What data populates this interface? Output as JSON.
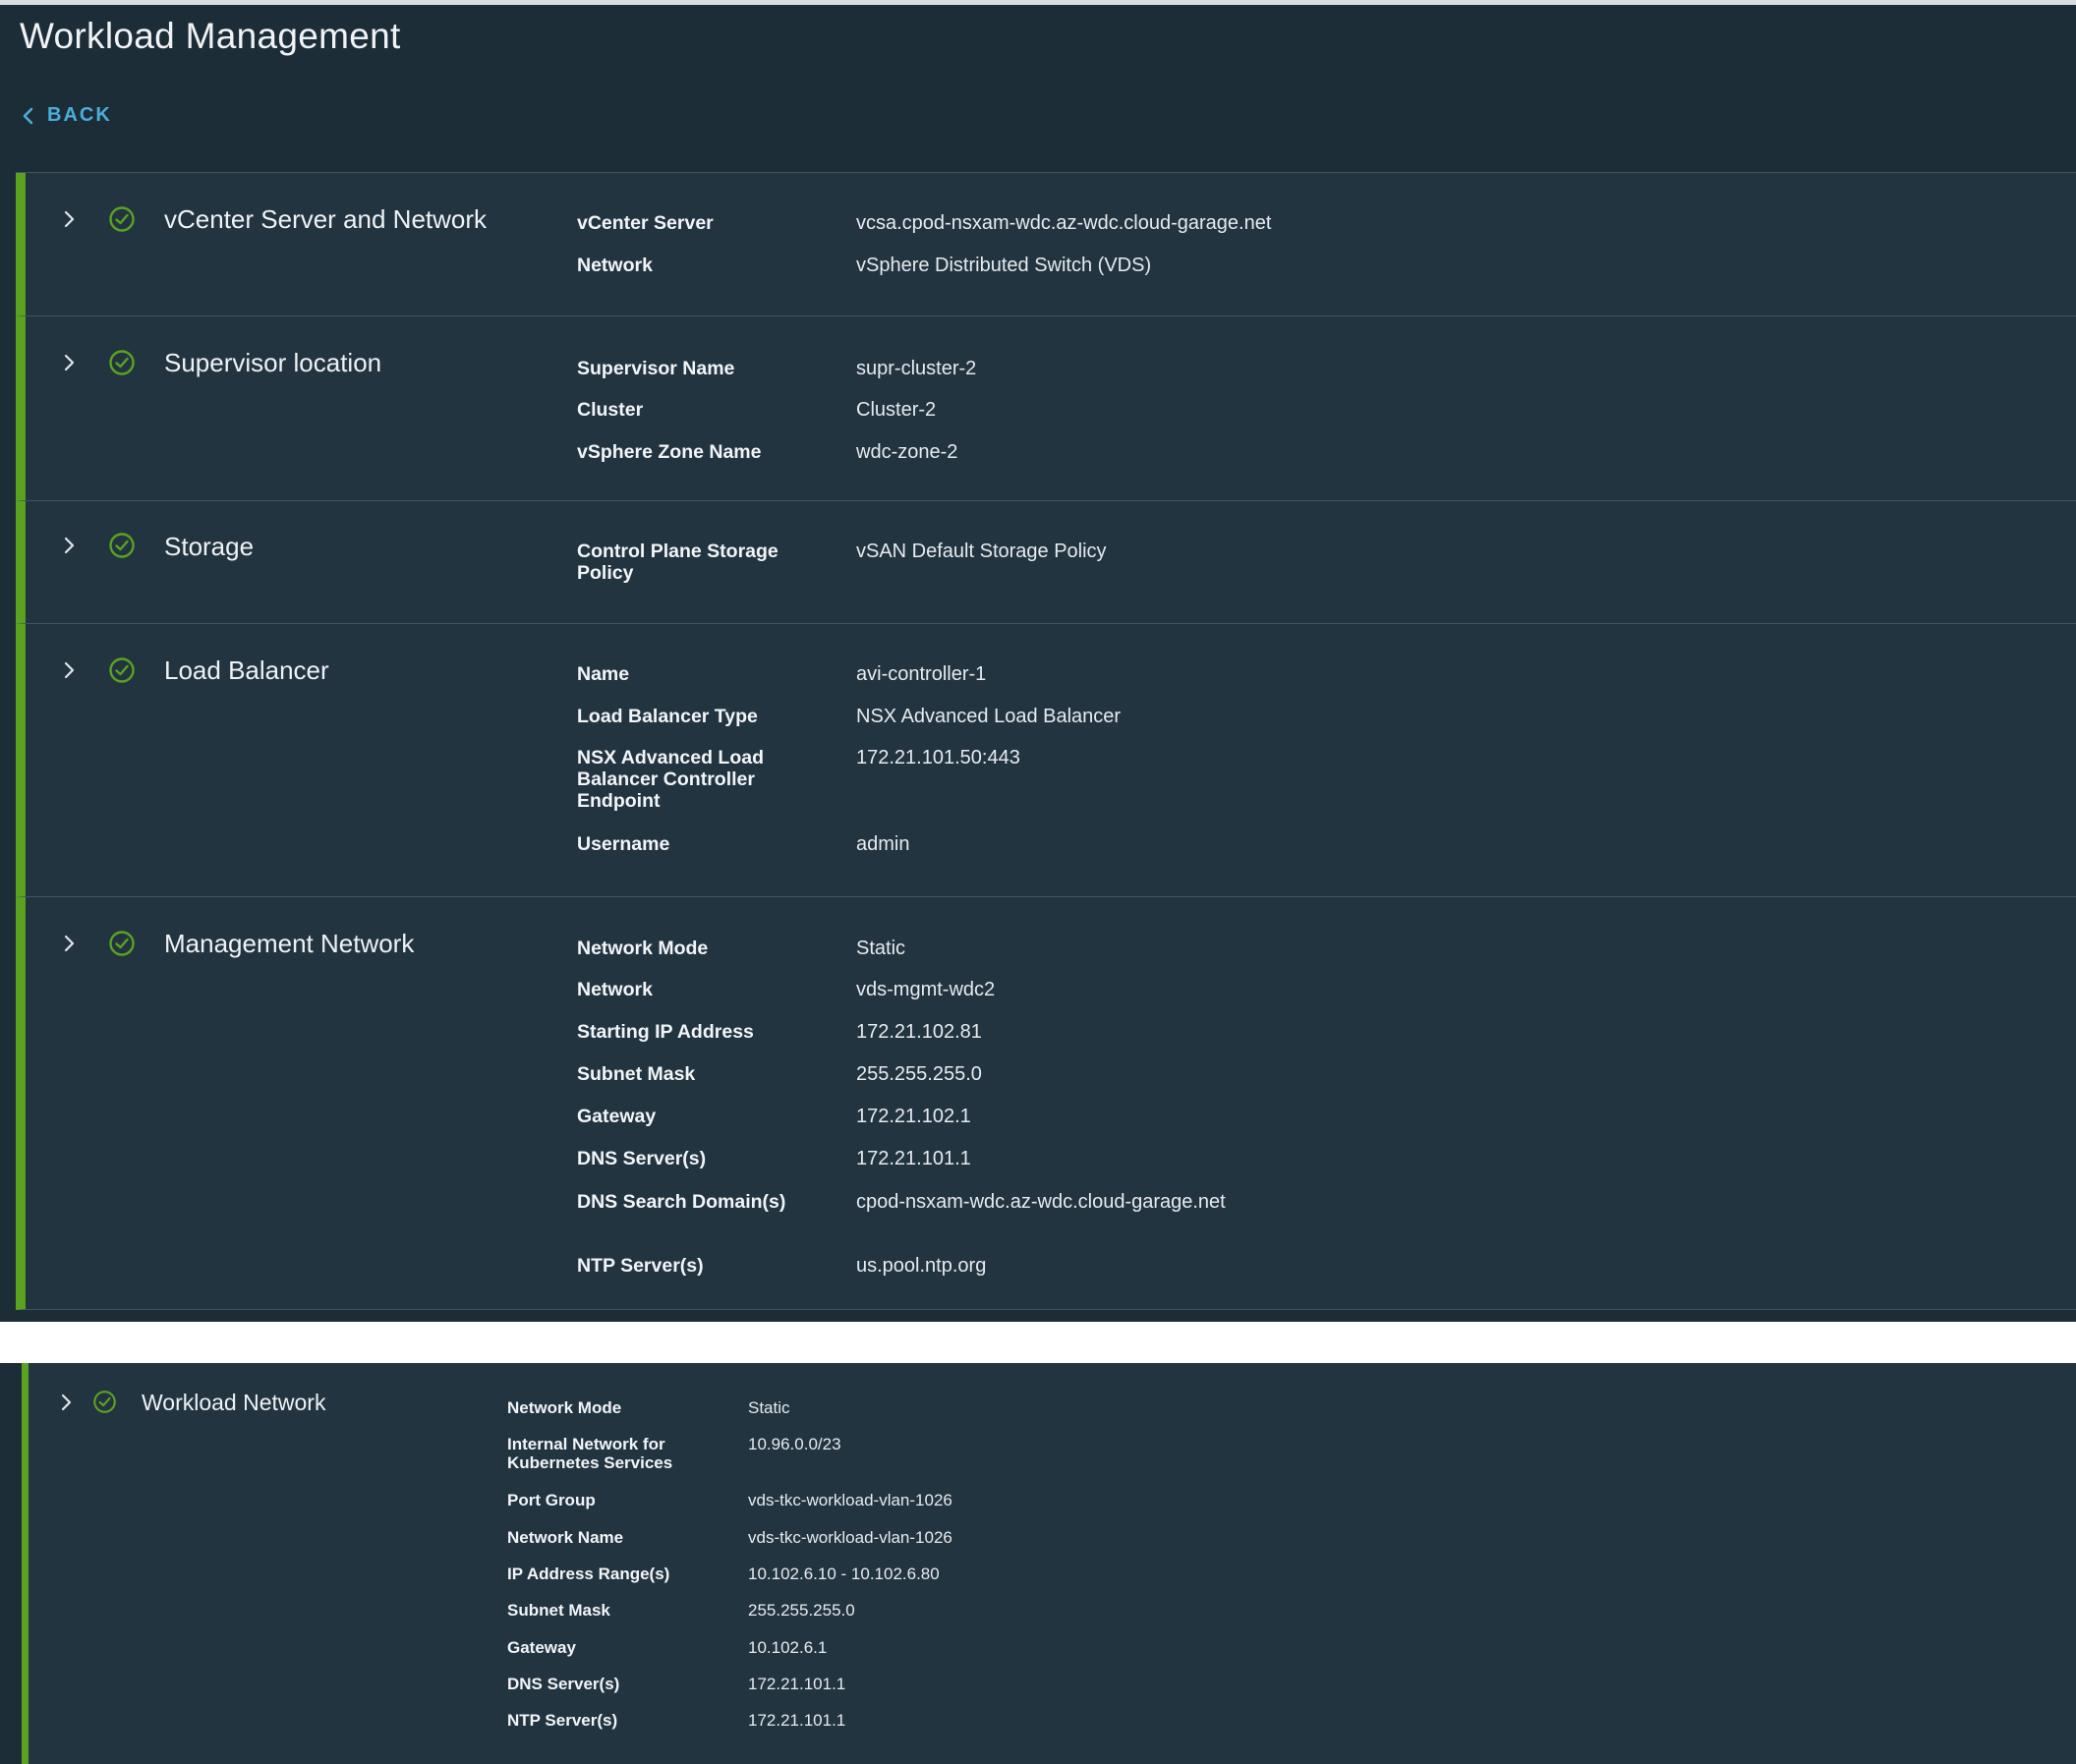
{
  "page": {
    "title": "Workload Management",
    "back_label": "BACK"
  },
  "colors": {
    "accent_green": "#5aa220",
    "link_blue": "#49afd9",
    "background": "#1d2d38"
  },
  "sections": [
    {
      "title": "vCenter Server and Network",
      "status": "check-circle-icon",
      "rows": [
        {
          "label": "vCenter Server",
          "value": "vcsa.cpod-nsxam-wdc.az-wdc.cloud-garage.net"
        },
        {
          "label": "Network",
          "value": "vSphere Distributed Switch (VDS)"
        }
      ]
    },
    {
      "title": "Supervisor location",
      "status": "check-circle-icon",
      "rows": [
        {
          "label": "Supervisor Name",
          "value": "supr-cluster-2"
        },
        {
          "label": "Cluster",
          "value": "Cluster-2"
        },
        {
          "label": "vSphere Zone Name",
          "value": "wdc-zone-2"
        }
      ]
    },
    {
      "title": "Storage",
      "status": "check-circle-icon",
      "rows": [
        {
          "label": "Control Plane Storage Policy",
          "value": "vSAN Default Storage Policy"
        }
      ]
    },
    {
      "title": "Load Balancer",
      "status": "check-circle-icon",
      "rows": [
        {
          "label": "Name",
          "value": "avi-controller-1"
        },
        {
          "label": "Load Balancer Type",
          "value": "NSX Advanced Load Balancer"
        },
        {
          "label": "NSX Advanced Load Balancer Controller Endpoint",
          "value": "172.21.101.50:443"
        },
        {
          "label": "Username",
          "value": "admin"
        }
      ]
    },
    {
      "title": "Management Network",
      "status": "check-circle-icon",
      "rows": [
        {
          "label": "Network Mode",
          "value": "Static"
        },
        {
          "label": "Network",
          "value": "vds-mgmt-wdc2"
        },
        {
          "label": "Starting IP Address",
          "value": "172.21.102.81"
        },
        {
          "label": "Subnet Mask",
          "value": "255.255.255.0"
        },
        {
          "label": "Gateway",
          "value": "172.21.102.1"
        },
        {
          "label": "DNS Server(s)",
          "value": "172.21.101.1"
        },
        {
          "label": "DNS Search Domain(s)",
          "value": "cpod-nsxam-wdc.az-wdc.cloud-garage.net"
        },
        {
          "label": "NTP Server(s)",
          "value": "us.pool.ntp.org"
        }
      ]
    }
  ],
  "workload_section": {
    "title": "Workload Network",
    "status": "check-circle-icon",
    "rows": [
      {
        "label": "Network Mode",
        "value": "Static"
      },
      {
        "label": "Internal Network for Kubernetes Services",
        "value": "10.96.0.0/23"
      },
      {
        "label": "Port Group",
        "value": "vds-tkc-workload-vlan-1026"
      },
      {
        "label": "Network Name",
        "value": "vds-tkc-workload-vlan-1026"
      },
      {
        "label": "IP Address Range(s)",
        "value": "10.102.6.10 - 10.102.6.80"
      },
      {
        "label": "Subnet Mask",
        "value": "255.255.255.0"
      },
      {
        "label": "Gateway",
        "value": "10.102.6.1"
      },
      {
        "label": "DNS Server(s)",
        "value": "172.21.101.1"
      },
      {
        "label": "NTP Server(s)",
        "value": "172.21.101.1"
      }
    ]
  }
}
